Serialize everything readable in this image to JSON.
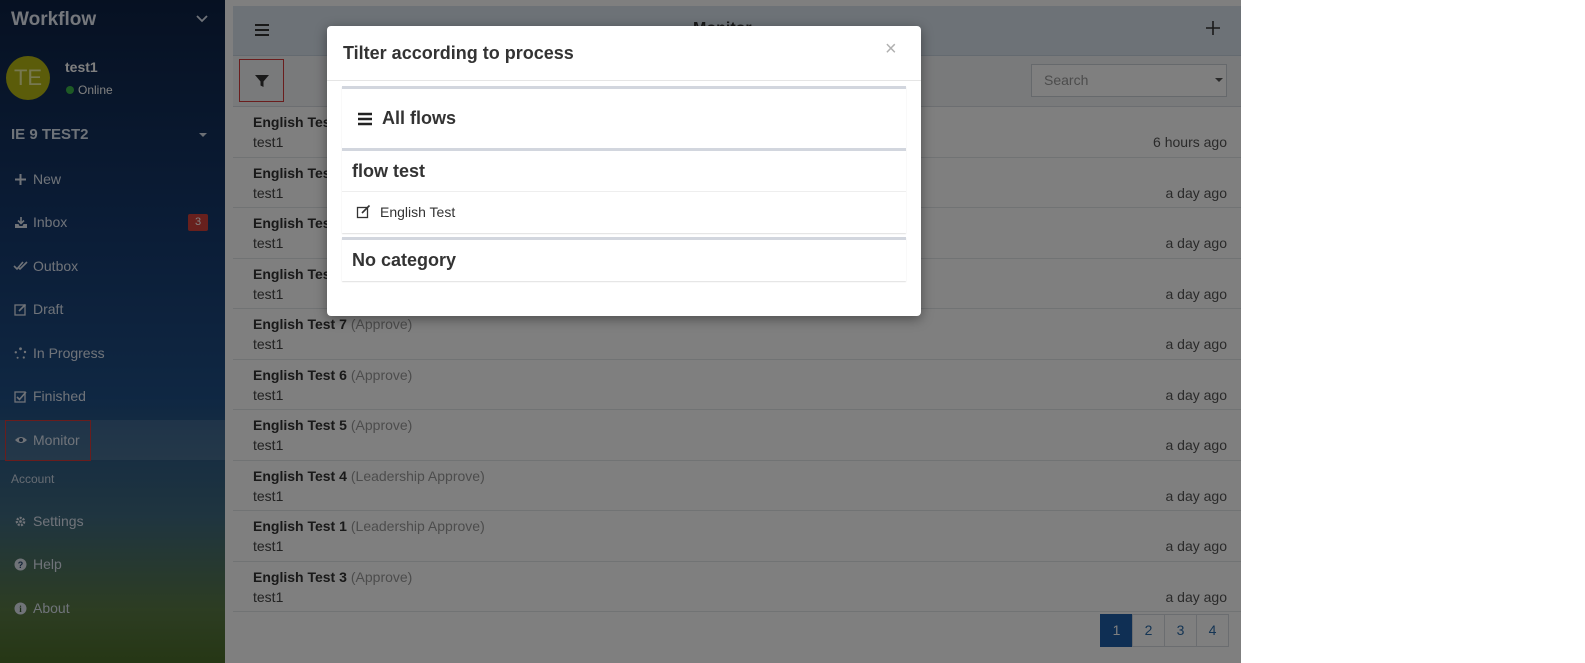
{
  "sidebar": {
    "brand": "Workflow",
    "user": {
      "initials": "TE",
      "name": "test1",
      "status": "Online"
    },
    "org": "IE 9 TEST2",
    "nav": [
      {
        "label": "New",
        "icon": "plus-icon"
      },
      {
        "label": "Inbox",
        "icon": "inbox-icon",
        "badge": "3"
      },
      {
        "label": "Outbox",
        "icon": "double-check-icon"
      },
      {
        "label": "Draft",
        "icon": "edit-icon"
      },
      {
        "label": "In Progress",
        "icon": "spinner-icon"
      },
      {
        "label": "Finished",
        "icon": "checkbox-icon"
      },
      {
        "label": "Monitor",
        "icon": "eye-icon"
      }
    ],
    "section_label": "Account",
    "account": [
      {
        "label": "Settings",
        "icon": "gear-icon"
      },
      {
        "label": "Help",
        "icon": "question-icon"
      },
      {
        "label": "About",
        "icon": "info-icon"
      }
    ]
  },
  "main": {
    "title": "Monitor",
    "search": {
      "placeholder": "Search"
    },
    "rows": [
      {
        "title": "English Test",
        "step": "",
        "user": "test1",
        "time": "6 hours ago"
      },
      {
        "title": "English Test",
        "step": "",
        "user": "test1",
        "time": "a day ago"
      },
      {
        "title": "English Test",
        "step": "",
        "user": "test1",
        "time": "a day ago"
      },
      {
        "title": "English Test",
        "step": "",
        "user": "test1",
        "time": "a day ago"
      },
      {
        "title": "English Test 7",
        "step": "(Approve)",
        "user": "test1",
        "time": "a day ago"
      },
      {
        "title": "English Test 6",
        "step": "(Approve)",
        "user": "test1",
        "time": "a day ago"
      },
      {
        "title": "English Test 5",
        "step": "(Approve)",
        "user": "test1",
        "time": "a day ago"
      },
      {
        "title": "English Test 4",
        "step": "(Leadership Approve)",
        "user": "test1",
        "time": "a day ago"
      },
      {
        "title": "English Test 1",
        "step": "(Leadership Approve)",
        "user": "test1",
        "time": "a day ago"
      },
      {
        "title": "English Test 3",
        "step": "(Approve)",
        "user": "test1",
        "time": "a day ago"
      }
    ],
    "pages": [
      "1",
      "2",
      "3",
      "4"
    ],
    "current_page": "1"
  },
  "modal": {
    "title": "Tilter according to process",
    "close": "×",
    "all_flows": "All flows",
    "groups": [
      {
        "name": "flow test",
        "items": [
          "English Test"
        ]
      },
      {
        "name": "No category",
        "items": []
      }
    ]
  },
  "colors": {
    "accent": "#1f5fa8",
    "badge": "#d0403a",
    "highlight": "#d43a3a"
  }
}
